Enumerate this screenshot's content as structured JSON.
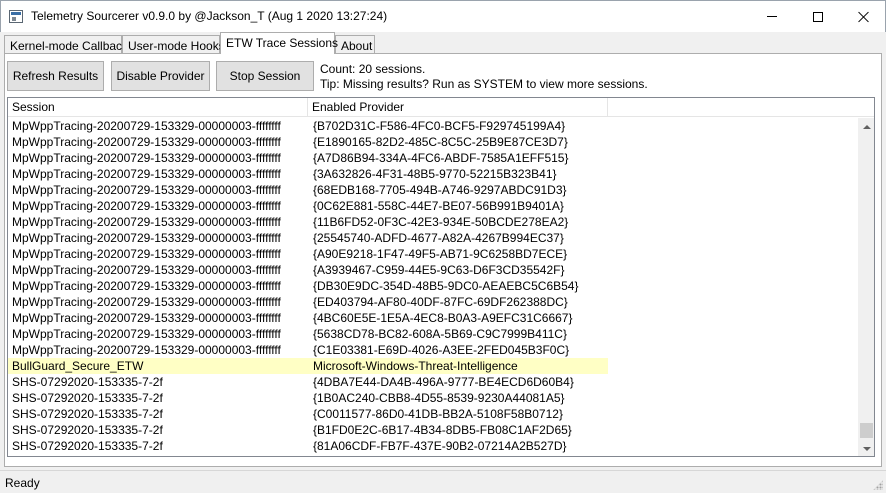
{
  "window": {
    "title": "Telemetry Sourcerer v0.9.0 by @Jackson_T (Aug  1 2020 13:27:24)"
  },
  "tabs": [
    {
      "label": "Kernel-mode Callbacks"
    },
    {
      "label": "User-mode Hooks"
    },
    {
      "label": "ETW Trace Sessions"
    },
    {
      "label": "About"
    }
  ],
  "toolbar": {
    "refresh_label": "Refresh Results",
    "disable_label": "Disable Provider",
    "stop_label": "Stop Session",
    "count_text": "Count: 20 sessions.",
    "tip_text": "Tip: Missing results? Run as SYSTEM to view more sessions."
  },
  "table": {
    "columns": [
      "Session",
      "Enabled Provider"
    ],
    "rows": [
      {
        "session": "MpWppTracing-20200729-153329-00000003-ffffffff",
        "provider": "{B702D31C-F586-4FC0-BCF5-F929745199A4}"
      },
      {
        "session": "MpWppTracing-20200729-153329-00000003-ffffffff",
        "provider": "{E1890165-82D2-485C-8C5C-25B9E87CE3D7}"
      },
      {
        "session": "MpWppTracing-20200729-153329-00000003-ffffffff",
        "provider": "{A7D86B94-334A-4FC6-ABDF-7585A1EFF515}"
      },
      {
        "session": "MpWppTracing-20200729-153329-00000003-ffffffff",
        "provider": "{3A632826-4F31-48B5-9770-52215B323B41}"
      },
      {
        "session": "MpWppTracing-20200729-153329-00000003-ffffffff",
        "provider": "{68EDB168-7705-494B-A746-9297ABDC91D3}"
      },
      {
        "session": "MpWppTracing-20200729-153329-00000003-ffffffff",
        "provider": "{0C62E881-558C-44E7-BE07-56B991B9401A}"
      },
      {
        "session": "MpWppTracing-20200729-153329-00000003-ffffffff",
        "provider": "{11B6FD52-0F3C-42E3-934E-50BCDE278EA2}"
      },
      {
        "session": "MpWppTracing-20200729-153329-00000003-ffffffff",
        "provider": "{25545740-ADFD-4677-A82A-4267B994EC37}"
      },
      {
        "session": "MpWppTracing-20200729-153329-00000003-ffffffff",
        "provider": "{A90E9218-1F47-49F5-AB71-9C6258BD7ECE}"
      },
      {
        "session": "MpWppTracing-20200729-153329-00000003-ffffffff",
        "provider": "{A3939467-C959-44E5-9C63-D6F3CD35542F}"
      },
      {
        "session": "MpWppTracing-20200729-153329-00000003-ffffffff",
        "provider": "{DB30E9DC-354D-48B5-9DC0-AEAEBC5C6B54}"
      },
      {
        "session": "MpWppTracing-20200729-153329-00000003-ffffffff",
        "provider": "{ED403794-AF80-40DF-87FC-69DF262388DC}"
      },
      {
        "session": "MpWppTracing-20200729-153329-00000003-ffffffff",
        "provider": "{4BC60E5E-1E5A-4EC8-B0A3-A9EFC31C6667}"
      },
      {
        "session": "MpWppTracing-20200729-153329-00000003-ffffffff",
        "provider": "{5638CD78-BC82-608A-5B69-C9C7999B411C}"
      },
      {
        "session": "MpWppTracing-20200729-153329-00000003-ffffffff",
        "provider": "{C1E03381-E69D-4026-A3EE-2FED045B3F0C}"
      },
      {
        "session": "BullGuard_Secure_ETW",
        "provider": "Microsoft-Windows-Threat-Intelligence",
        "highlight": true
      },
      {
        "session": "SHS-07292020-153335-7-2f",
        "provider": "{4DBA7E44-DA4B-496A-9777-BE4ECD6D60B4}"
      },
      {
        "session": "SHS-07292020-153335-7-2f",
        "provider": "{1B0AC240-CBB8-4D55-8539-9230A44081A5}"
      },
      {
        "session": "SHS-07292020-153335-7-2f",
        "provider": "{C0011577-86D0-41DB-BB2A-5108F58B0712}"
      },
      {
        "session": "SHS-07292020-153335-7-2f",
        "provider": "{B1FD0E2C-6B17-4B34-8DB5-FB08C1AF2D65}"
      },
      {
        "session": "SHS-07292020-153335-7-2f",
        "provider": "{81A06CDF-FB7F-437E-90B2-07214A2B527D}"
      }
    ],
    "highlight_color": "#ffffc5"
  },
  "statusbar": {
    "text": "Ready"
  },
  "icons": {
    "app": "app-icon",
    "minimize": "minimize-icon",
    "maximize": "maximize-icon",
    "close": "close-icon",
    "scroll_up": "scroll-up-arrow-icon",
    "scroll_down": "scroll-down-arrow-icon",
    "grip": "resize-grip-icon"
  }
}
